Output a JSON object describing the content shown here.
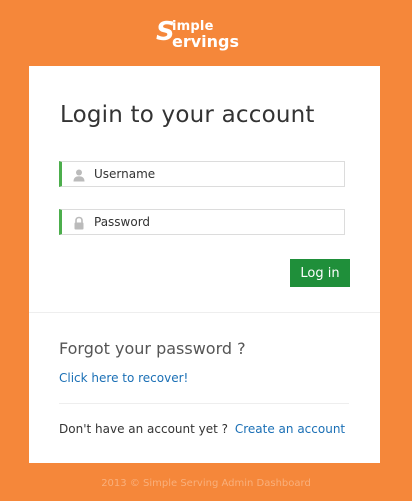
{
  "logo": {
    "initial": "S",
    "line1": "imple",
    "line2": "ervings"
  },
  "login": {
    "title": "Login to your account",
    "username_placeholder": "Username",
    "password_placeholder": "Password",
    "submit_label": "Log in"
  },
  "recovery": {
    "heading": "Forgot your password ?",
    "link": "Click here to recover!"
  },
  "signup": {
    "prompt": "Don't have an account yet ?",
    "link": "Create an account"
  },
  "footer": {
    "text": "2013 © Simple Serving Admin Dashboard"
  },
  "colors": {
    "background": "#f5873a",
    "accent_green": "#1f8f3a",
    "field_border_accent": "#4cae4c",
    "link": "#1a6fb5"
  },
  "icons": {
    "username": "user-icon",
    "password": "lock-icon"
  }
}
